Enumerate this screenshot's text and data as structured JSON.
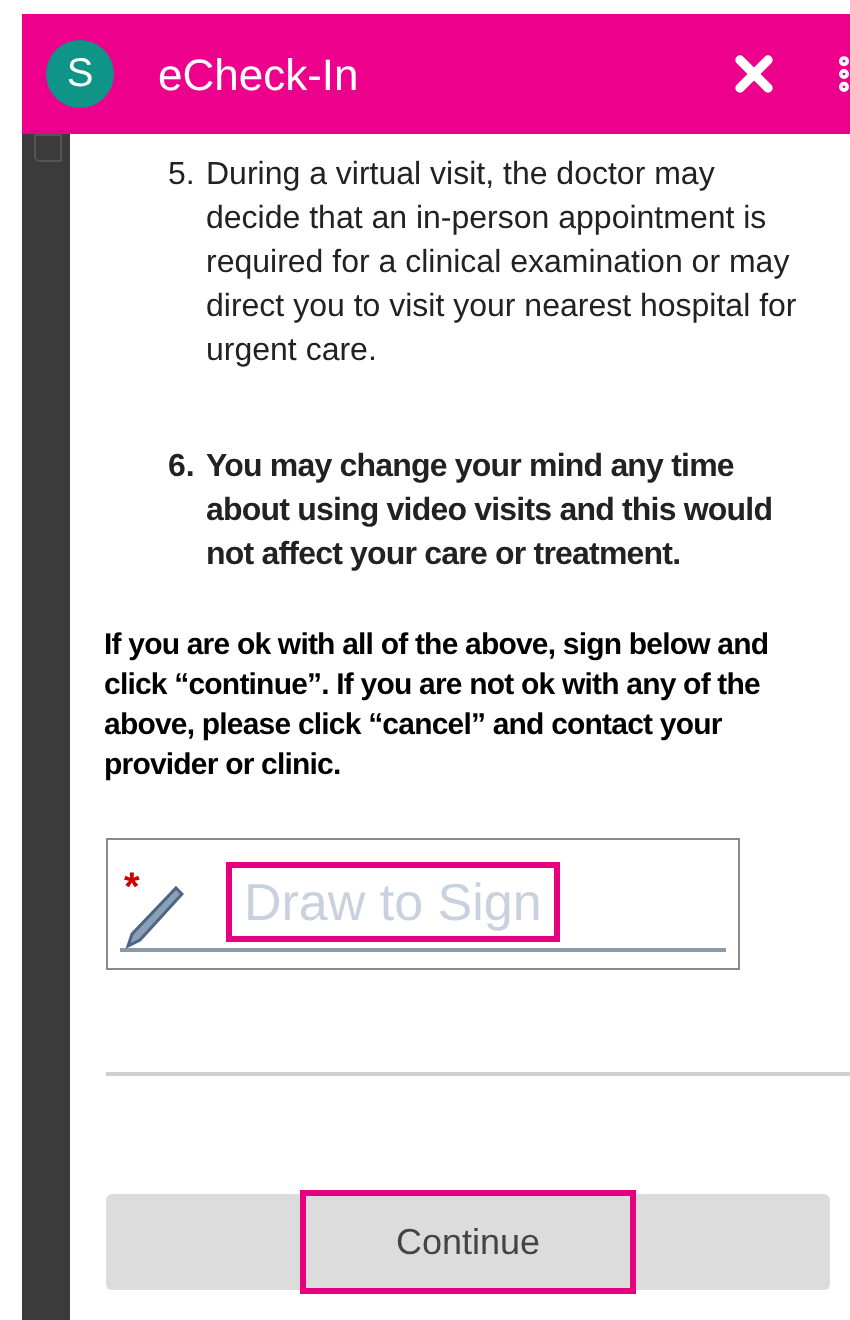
{
  "header": {
    "avatar_letter": "S",
    "title": "eCheck-In"
  },
  "items": [
    {
      "number": "5.",
      "text": "During a virtual visit, the doctor may decide that an in-person appointment is required for a clinical examination or may direct you to visit your nearest hospital for urgent care.",
      "emphasis": false
    },
    {
      "number": "6.",
      "text": "You may change your mind any time about using video visits and this would not affect your care or treatment.",
      "emphasis": true
    }
  ],
  "instructions": "If you are ok with all of the above, sign below and click “continue”. If you are not ok with any of the above, please click “cancel” and contact your provider or clinic.",
  "signature": {
    "required_mark": "*",
    "placeholder": "Draw to Sign",
    "highlighted": true
  },
  "continue_button": {
    "label": "Continue",
    "highlighted": true
  }
}
